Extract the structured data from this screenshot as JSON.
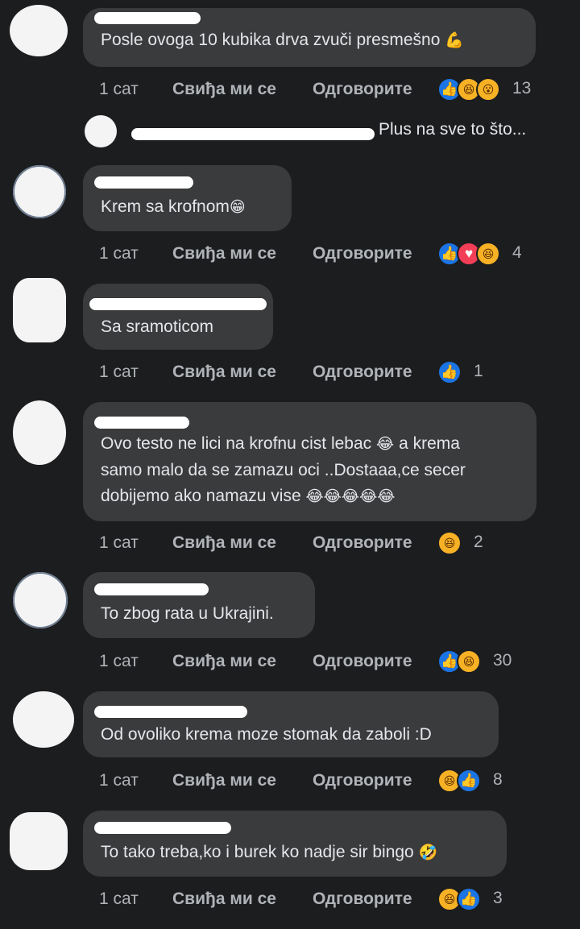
{
  "actions": {
    "time": "1 сат",
    "like": "Свиђа ми се",
    "reply": "Одговорите"
  },
  "icons": {
    "like": "👍",
    "heart": "♥",
    "haha": "😆",
    "wow": "😮"
  },
  "colors": {
    "background": "#1c1d1f",
    "bubble": "#3a3b3c",
    "like": "#1b74e4",
    "heart": "#f33e58",
    "haha": "#f7b125"
  },
  "reply_preview": {
    "text": "Plus na sve to što..."
  },
  "comments": [
    {
      "text": "Posle ovoga 10 kubika drva zvuči presmešno",
      "emoji": "💪",
      "reactions": [
        "like",
        "haha",
        "wow"
      ],
      "count": "13"
    },
    {
      "text": "Krem sa krofnom",
      "emoji": "😁",
      "reactions": [
        "like",
        "heart",
        "haha"
      ],
      "count": "4"
    },
    {
      "text": "Sa sramoticom",
      "reactions": [
        "like"
      ],
      "count": "1"
    },
    {
      "line1": "Ovo testo ne lici na krofnu cist lebac",
      "line1_emoji": "😂",
      "line1_tail": "a krema",
      "line2": "samo malo da se zamazu oci ..Dostaaa,ce secer",
      "line3": "dobijemo ako namazu vise",
      "line3_emoji": "😂😂😂😂😂",
      "reactions": [
        "haha"
      ],
      "count": "2"
    },
    {
      "text": "To zbog rata u Ukrajini.",
      "reactions": [
        "like",
        "haha"
      ],
      "count": "30"
    },
    {
      "text": "Od ovoliko krema moze stomak da zaboli :D",
      "reactions": [
        "haha",
        "like"
      ],
      "count": "8"
    },
    {
      "text": "To tako treba,ko i burek ko nadje sir bingo",
      "emoji": "🤣",
      "reactions": [
        "haha",
        "like"
      ],
      "count": "3"
    }
  ]
}
